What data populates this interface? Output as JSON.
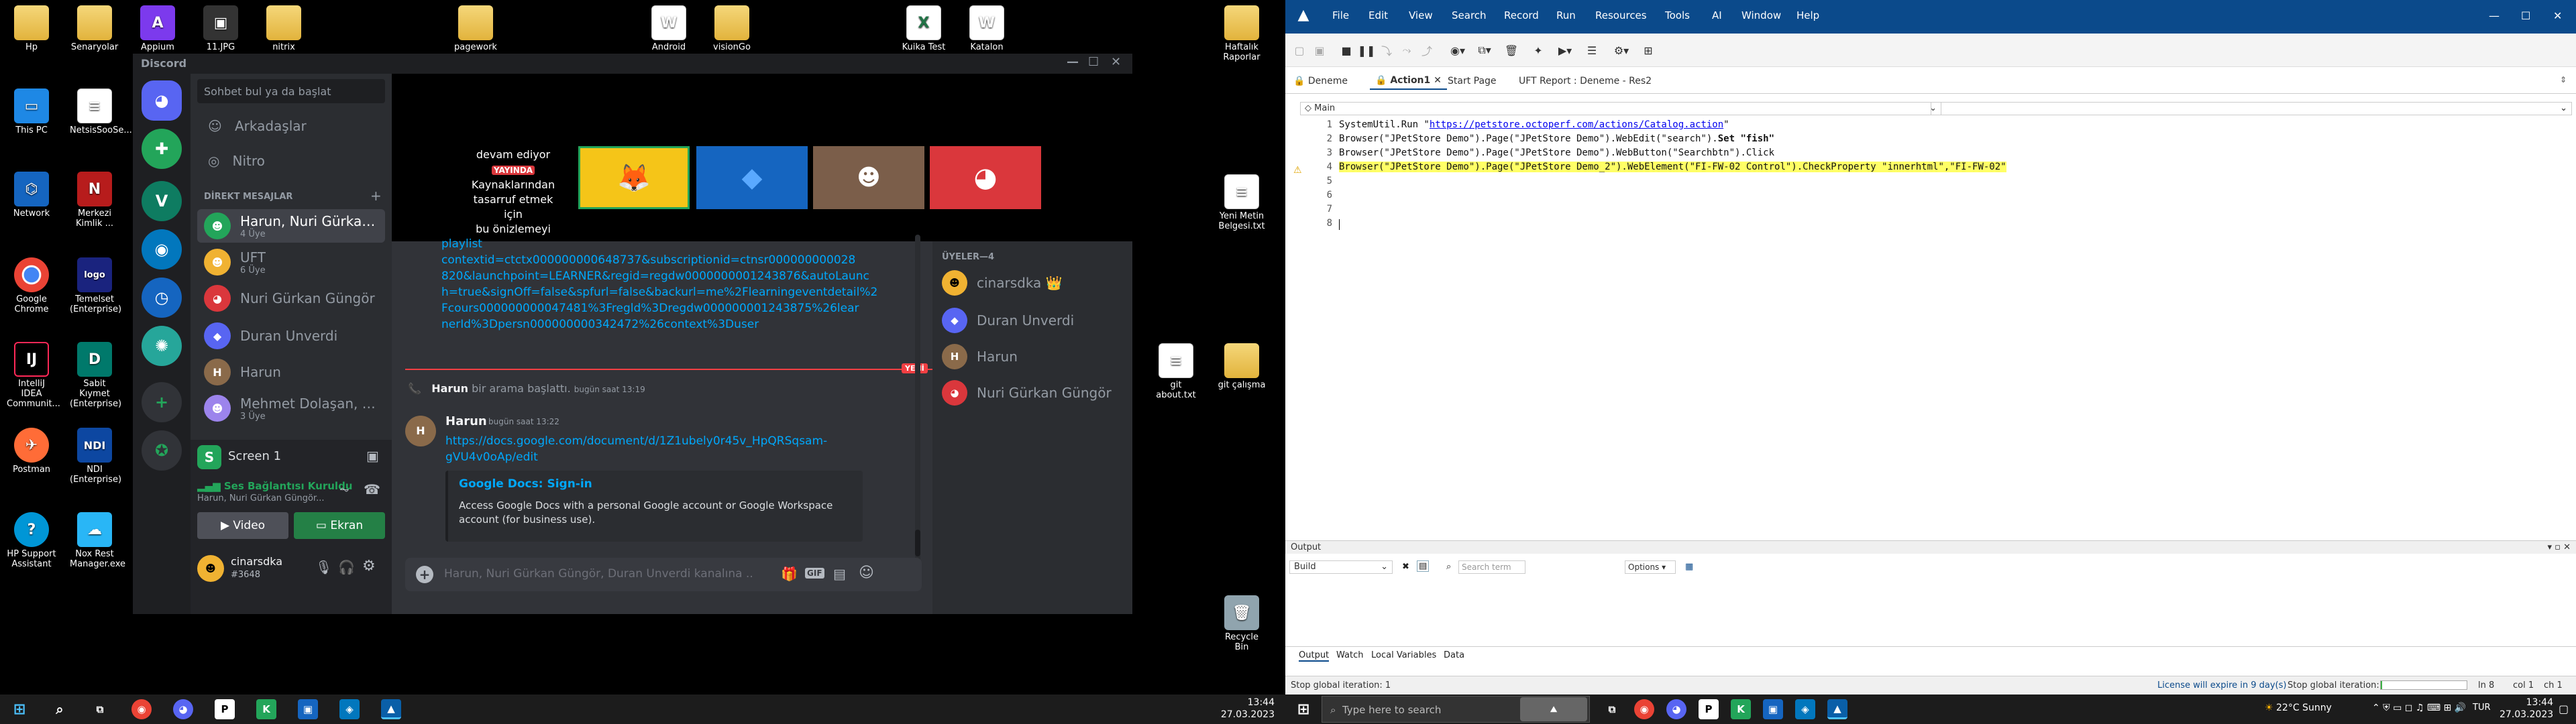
{
  "desktop_left": {
    "icons": [
      {
        "label": "Hp",
        "glyph": "📁"
      },
      {
        "label": "Senaryolar",
        "glyph": "📁"
      },
      {
        "label": "Appium",
        "glyph": "A"
      },
      {
        "label": "11.JPG",
        "glyph": "🖼"
      },
      {
        "label": "nitrix",
        "glyph": "📁"
      },
      {
        "label": "This PC",
        "glyph": "🖥"
      },
      {
        "label": "NetsisSooSe...",
        "glyph": "📄"
      },
      {
        "label": "Network",
        "glyph": "🌐"
      },
      {
        "label": "Merkezi Kimlik ...",
        "glyph": "N"
      },
      {
        "label": "Google Chrome",
        "glyph": "◉"
      },
      {
        "label": "Temelset (Enterprise)",
        "glyph": "logo"
      },
      {
        "label": "IntelliJ IDEA Communit...",
        "glyph": "IJ"
      },
      {
        "label": "Sabit Kıymet (Enterprise)",
        "glyph": "D"
      },
      {
        "label": "Postman",
        "glyph": "✈"
      },
      {
        "label": "NDI (Enterprise)",
        "glyph": "NDI"
      },
      {
        "label": "HP Support Assistant",
        "glyph": "?"
      },
      {
        "label": "Nox Rest Manager.exe",
        "glyph": "☁"
      }
    ]
  },
  "desktop_top": [
    {
      "label": "pagework",
      "glyph": "📁"
    },
    {
      "label": "Android",
      "glyph": "W"
    },
    {
      "label": "visionGo",
      "glyph": "📁"
    },
    {
      "label": "Kuika Test",
      "glyph": "X"
    },
    {
      "label": "Katalon",
      "glyph": "W"
    }
  ],
  "desktop_right": [
    {
      "label": "Haftalık Raporlar",
      "glyph": "📁"
    },
    {
      "label": "Yeni Metin Belgesi.txt",
      "glyph": "📄"
    },
    {
      "label": "git about.txt",
      "glyph": "📄"
    },
    {
      "label": "git çalışma",
      "glyph": "📁"
    },
    {
      "label": "Recycle Bin",
      "glyph": "🗑"
    }
  ],
  "discord": {
    "title": "Discord",
    "search_placeholder": "Sohbet bul ya da başlat",
    "nav": [
      "Arkadaşlar",
      "Nitro"
    ],
    "dm_header": "DİREKT MESAJLAR",
    "dms": [
      {
        "name": "Harun, Nuri Gürkan G...",
        "sub": "4 Üye",
        "color": "#23a55a"
      },
      {
        "name": "UFT",
        "sub": "6 Üye",
        "color": "#f0b232"
      },
      {
        "name": "Nuri Gürkan Güngör",
        "sub": "",
        "color": "#da373c"
      },
      {
        "name": "Duran Unverdi",
        "sub": "",
        "color": "#5865f2"
      },
      {
        "name": "Harun",
        "sub": "",
        "color": "#8a6a4a"
      },
      {
        "name": "Mehmet Dolaşan, Dur...",
        "sub": "3 Üye",
        "color": "#9c84ec"
      }
    ],
    "screen": {
      "label": "Screen 1"
    },
    "voice": {
      "status": "Ses Bağlantısı Kuruldu",
      "channel": "Harun, Nuri Gürkan Güngör..."
    },
    "video_btn": "Video",
    "screen_btn": "Ekran",
    "user": {
      "name": "cinarsdka",
      "tag": "#3648"
    },
    "ad": {
      "line1": "devam ediyor",
      "badge": "YAYINDA",
      "line2": "Kaynaklarından",
      "line3": "tasarruf etmek için",
      "line4": "bu önizlemeyi"
    },
    "link_text_1": "playlist",
    "link_text_2": "contextid=ctctx000000000648737&subscriptionid=ctnsr000000000028",
    "link_text_3": "820&launchpoint=LEARNER&regid=regdw0000000001243876&autoLaunc",
    "link_text_4": "h=true&signOff=false&spfurl=false&backurl=me%2Flearningeventdetail%2",
    "link_text_5": "Fcours000000000047481%3Fregld%3Dregdw000000001243875%26lear",
    "link_text_6": "nerId%3Dpersn000000000342472%26context%3Duser",
    "new_badge": "YENİ",
    "call_text": {
      "name": "Harun",
      "rest": "bir arama başlattı.",
      "time": "bugün saat 13:19"
    },
    "message": {
      "author": "Harun",
      "time": "bugün saat 13:22",
      "url_1": "https://docs.google.com/document/d/1Z1ubely0r45v_HpQRSqsam-",
      "url_2": "gVU4v0oAp/edit",
      "embed_title": "Google Docs: Sign-in",
      "embed_desc_1": "Access Google Docs with a personal Google account or Google Workspace",
      "embed_desc_2": "account (for business use)."
    },
    "input_placeholder": "Harun, Nuri Gürkan Güngör, Duran Unverdi kanalına ...",
    "members_header": "ÜYELER—4",
    "members": [
      {
        "name": "cinarsdka",
        "crown": "👑",
        "color": "#3ba55d"
      },
      {
        "name": "Duran Unverdi",
        "crown": "",
        "color": "#5865f2"
      },
      {
        "name": "Harun",
        "crown": "",
        "color": "#8a6a4a"
      },
      {
        "name": "Nuri Gürkan Güngör",
        "crown": "",
        "color": "#da373c"
      }
    ]
  },
  "uft": {
    "menu": [
      "File",
      "Edit",
      "View",
      "Search",
      "Record",
      "Run",
      "Resources",
      "Tools",
      "AI",
      "Window",
      "Help"
    ],
    "tabs": [
      "Deneme",
      "Action1",
      "Start Page",
      "UFT Report : Deneme - Res2"
    ],
    "scope_select": "Main",
    "code": [
      {
        "n": "1",
        "pre": "SystemUtil.Run \"",
        "url": "https://petstore.octoperf.com/actions/Catalog.action",
        "post": "\""
      },
      {
        "n": "2",
        "pre": "Browser(\"JPetStore Demo\").Page(\"JPetStore Demo\").WebEdit(\"search\").",
        "url": "",
        "post": "Set \"fish\""
      },
      {
        "n": "3",
        "pre": "Browser(\"JPetStore Demo\").Page(\"JPetStore Demo\").WebButton(\"Searchbtn\").Click",
        "url": "",
        "post": ""
      },
      {
        "n": "4",
        "pre": "Browser(\"JPetStore Demo\").Page(\"JPetStore Demo_2\").WebElement(\"FI-FW-02 Control\").CheckProperty \"innerhtml\",\"FI-FW-02\"",
        "url": "",
        "post": ""
      },
      {
        "n": "5",
        "pre": "",
        "url": "",
        "post": ""
      },
      {
        "n": "6",
        "pre": "",
        "url": "",
        "post": ""
      },
      {
        "n": "7",
        "pre": "",
        "url": "",
        "post": ""
      },
      {
        "n": "8",
        "pre": "",
        "url": "",
        "post": ""
      }
    ],
    "output_title": "Output",
    "output_select": "Build",
    "search_placeholder": "Search term",
    "options_label": "Options",
    "bottom_tabs": [
      "Output",
      "Watch",
      "Local Variables",
      "Data"
    ],
    "status_left": "Stop global iteration: 1",
    "license": "License will expire in 9 day(s)",
    "status_right": "Stop global iteration: 1",
    "ln": "ln 8",
    "col": "col 1",
    "ch": "ch 1"
  },
  "taskbar_left": {
    "time": "13:44",
    "date": "27.03.2023"
  },
  "taskbar_right": {
    "search_placeholder": "Type here to search",
    "weather": "22°C  Sunny",
    "lang": "TUR",
    "time": "13:44",
    "date": "27.03.2023"
  }
}
